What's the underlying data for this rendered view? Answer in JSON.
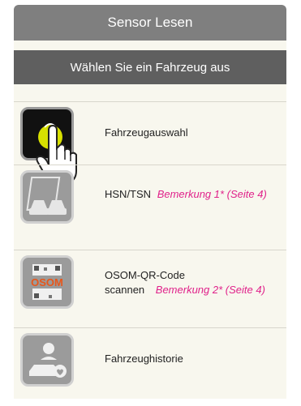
{
  "header": {
    "title": "Sensor Lesen"
  },
  "subheader": {
    "title": "Wählen Sie ein Fahrzeug aus"
  },
  "options": [
    {
      "label": "Fahrzeugauswahl",
      "icon": "key-fob-touch-icon",
      "note": ""
    },
    {
      "label": "HSN/TSN",
      "icon": "car-registration-doc-icon",
      "note": "Bemerkung 1* (Seite 4)"
    },
    {
      "label_line1": "OSOM-QR-Code",
      "label_line2": "scannen",
      "icon": "osom-qr-icon",
      "icon_text": "OSOM",
      "note": "Bemerkung 2* (Seite 4)"
    },
    {
      "label": "Fahrzeughistorie",
      "icon": "vehicle-history-icon",
      "note": ""
    }
  ],
  "colors": {
    "accent_note": "#e0218a",
    "header": "#7f7f7f",
    "subheader": "#5f5f5f",
    "tile": "#9b9b9b"
  }
}
